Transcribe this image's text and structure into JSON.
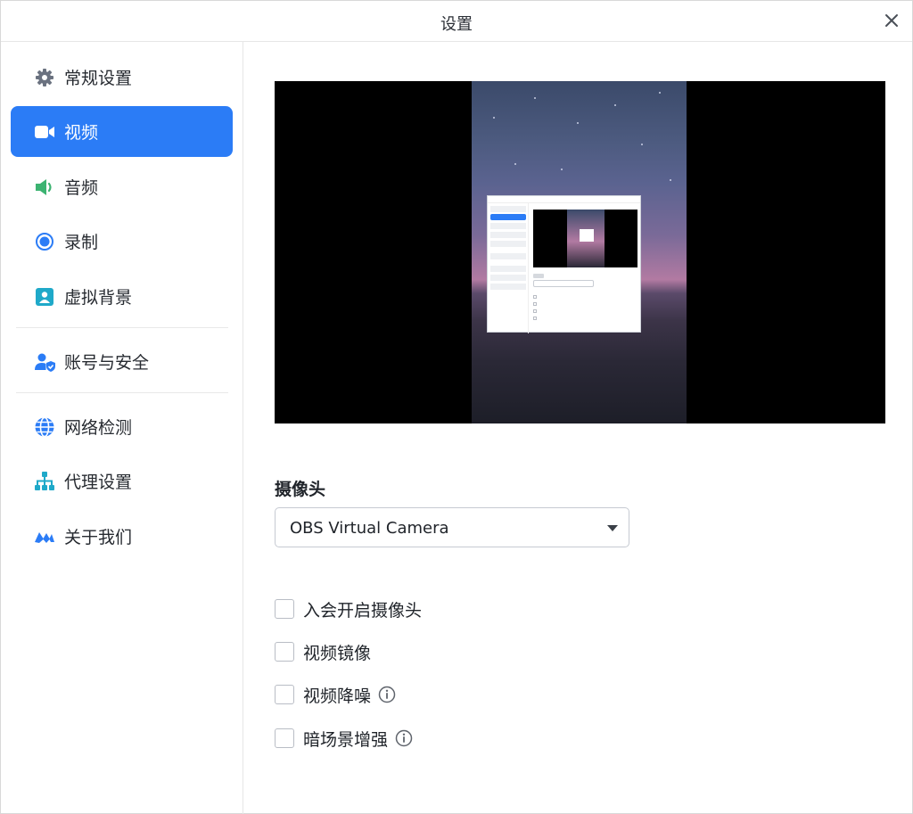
{
  "window": {
    "title": "设置"
  },
  "sidebar": {
    "items": [
      {
        "label": "常规设置",
        "icon": "gear-icon"
      },
      {
        "label": "视频",
        "icon": "video-camera-icon",
        "active": true
      },
      {
        "label": "音频",
        "icon": "speaker-icon"
      },
      {
        "label": "录制",
        "icon": "record-icon"
      },
      {
        "label": "虚拟背景",
        "icon": "virtual-background-icon"
      },
      {
        "label": "账号与安全",
        "icon": "account-security-icon"
      },
      {
        "label": "网络检测",
        "icon": "globe-icon"
      },
      {
        "label": "代理设置",
        "icon": "network-tree-icon"
      },
      {
        "label": "关于我们",
        "icon": "brand-logo-icon"
      }
    ]
  },
  "main": {
    "camera_title": "摄像头",
    "camera_select": {
      "value": "OBS Virtual Camera"
    },
    "options": [
      {
        "label": "入会开启摄像头",
        "checked": false,
        "info": false
      },
      {
        "label": "视频镜像",
        "checked": false,
        "info": false
      },
      {
        "label": "视频降噪",
        "checked": false,
        "info": true
      },
      {
        "label": "暗场景增强",
        "checked": false,
        "info": true
      }
    ]
  },
  "colors": {
    "accent": "#2b7cf6",
    "speaker": "#3cb371",
    "icon_blue": "#2b7cf6",
    "icon_gray": "#6b7280",
    "icon_teal": "#1fa9c9"
  }
}
